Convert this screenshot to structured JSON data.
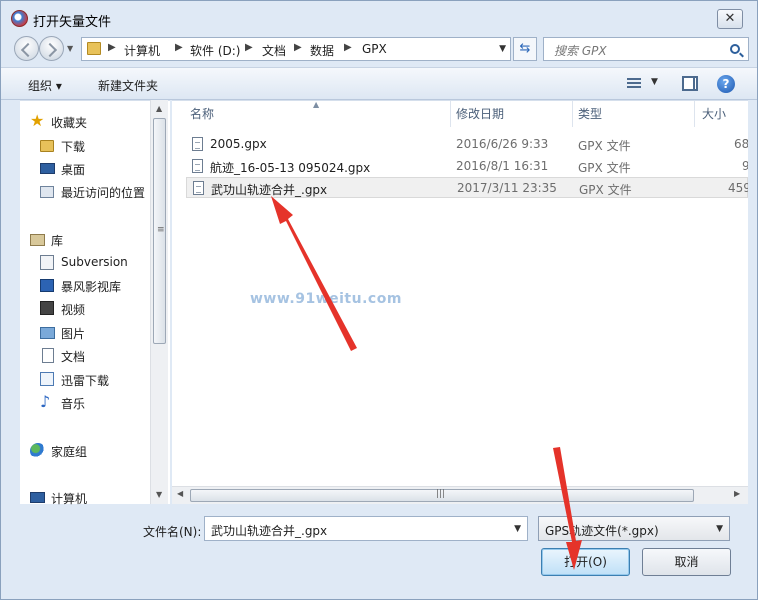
{
  "window": {
    "title": "打开矢量文件",
    "close_label": "✕"
  },
  "nav": {
    "breadcrumbs": [
      "计算机",
      "软件 (D:)",
      "文档",
      "数据",
      "GPX"
    ],
    "search_placeholder": "搜索 GPX"
  },
  "toolbar": {
    "organize_label": "组织 ▾",
    "new_folder_label": "新建文件夹",
    "help_label": "?"
  },
  "sidebar": {
    "items": [
      {
        "label": "收藏夹",
        "icon": "star-icon"
      },
      {
        "label": "下载",
        "icon": "folder-icon"
      },
      {
        "label": "桌面",
        "icon": "desktop-icon"
      },
      {
        "label": "最近访问的位置",
        "icon": "recent-places-icon"
      },
      {
        "label": "库",
        "icon": "library-icon"
      },
      {
        "label": "Subversion",
        "icon": "document-icon"
      },
      {
        "label": "暴风影视库",
        "icon": "media-library-icon"
      },
      {
        "label": "视频",
        "icon": "video-icon"
      },
      {
        "label": "图片",
        "icon": "picture-icon"
      },
      {
        "label": "文档",
        "icon": "document-icon"
      },
      {
        "label": "迅雷下载",
        "icon": "download-icon"
      },
      {
        "label": "音乐",
        "icon": "music-icon"
      },
      {
        "label": "家庭组",
        "icon": "homegroup-icon"
      },
      {
        "label": "计算机",
        "icon": "computer-icon"
      }
    ]
  },
  "filelist": {
    "columns": {
      "name": "名称",
      "modified": "修改日期",
      "type": "类型",
      "size": "大小"
    },
    "rows": [
      {
        "name": "2005.gpx",
        "modified": "2016/6/26 9:33",
        "type": "GPX 文件",
        "size": "68"
      },
      {
        "name": "航迹_16-05-13 095024.gpx",
        "modified": "2016/8/1 16:31",
        "type": "GPX 文件",
        "size": "9"
      },
      {
        "name": "武功山轨迹合并_.gpx",
        "modified": "2017/3/11 23:35",
        "type": "GPX 文件",
        "size": "459"
      }
    ],
    "watermark": "www.91weitu.com"
  },
  "bottom": {
    "filename_label": "文件名(N):",
    "filename_value": "武功山轨迹合并_.gpx",
    "filter_value": "GPS轨迹文件(*.gpx)",
    "open_label": "打开(O)",
    "cancel_label": "取消"
  },
  "colors": {
    "accent": "#3c7fb1",
    "arrow": "#e5332a",
    "window_bg": "#dfe9f5"
  }
}
